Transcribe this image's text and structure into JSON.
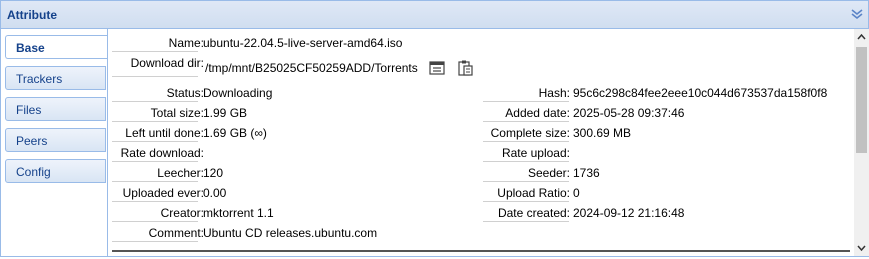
{
  "panel": {
    "title": "Attribute"
  },
  "tabs": [
    "Base",
    "Trackers",
    "Files",
    "Peers",
    "Config"
  ],
  "fields": {
    "name_label": "Name:",
    "name": "ubuntu-22.04.5-live-server-amd64.iso",
    "download_dir_label": "Download dir:",
    "download_dir": "/tmp/mnt/B25025CF50259ADD/Torrents",
    "status_label": "Status:",
    "status": "Downloading",
    "hash_label": "Hash:",
    "hash": "95c6c298c84fee2eee10c044d673537da158f0f8",
    "total_size_label": "Total size:",
    "total_size": "1.99 GB",
    "added_date_label": "Added date:",
    "added_date": "2025-05-28 09:37:46",
    "left_until_done_label": "Left until done:",
    "left_until_done": "1.69 GB (∞)",
    "complete_size_label": "Complete size:",
    "complete_size": "300.69 MB",
    "rate_download_label": "Rate download:",
    "rate_download": "",
    "rate_upload_label": "Rate upload:",
    "rate_upload": "",
    "leecher_label": "Leecher:",
    "leecher": "120",
    "seeder_label": "Seeder:",
    "seeder": "1736",
    "uploaded_ever_label": "Uploaded ever:",
    "uploaded_ever": "0.00",
    "upload_ratio_label": "Upload Ratio:",
    "upload_ratio": "0",
    "creator_label": "Creator:",
    "creator": "mktorrent 1.1",
    "date_created_label": "Date created:",
    "date_created": "2024-09-12 21:16:48",
    "comment_label": "Comment:",
    "comment": "Ubuntu CD releases.ubuntu.com"
  },
  "icons": {
    "collapse": "double-chevron-down-icon",
    "open_dir": "folder-list-icon",
    "copy": "clipboard-copy-icon"
  },
  "colors": {
    "header_bg": "#dfe8f6",
    "border": "#99bbe8",
    "title": "#15428b"
  }
}
